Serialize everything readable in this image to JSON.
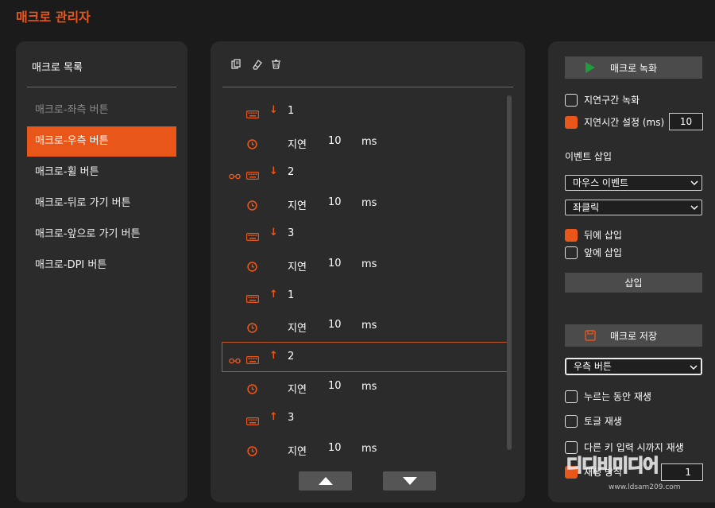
{
  "app": {
    "title": "매크로 관리자"
  },
  "colors": {
    "accent": "#e8561a",
    "panel": "#2b2b2b",
    "background": "#1b1b1b"
  },
  "left": {
    "header": "매크로 목록",
    "items": [
      {
        "label": "매크로-좌측 버튼",
        "state": "dim"
      },
      {
        "label": "매크로-우측 버튼",
        "state": "selected"
      },
      {
        "label": "매크로-휠 버튼",
        "state": "normal"
      },
      {
        "label": "매크로-뒤로 가기 버튼",
        "state": "normal"
      },
      {
        "label": "매크로-앞으로 가기 버튼",
        "state": "normal"
      },
      {
        "label": "매크로-DPI 버튼",
        "state": "normal"
      }
    ]
  },
  "middle": {
    "toolbar": [
      "copy-icon",
      "eraser-icon",
      "trash-icon"
    ],
    "events": [
      {
        "type": "key",
        "link": false,
        "direction": "↓",
        "key": "1"
      },
      {
        "type": "delay",
        "label": "지연",
        "value": "10",
        "unit": "ms"
      },
      {
        "type": "key",
        "link": true,
        "direction": "↓",
        "key": "2"
      },
      {
        "type": "delay",
        "label": "지연",
        "value": "10",
        "unit": "ms"
      },
      {
        "type": "key",
        "link": false,
        "direction": "↓",
        "key": "3"
      },
      {
        "type": "delay",
        "label": "지연",
        "value": "10",
        "unit": "ms"
      },
      {
        "type": "key",
        "link": false,
        "direction": "↑",
        "key": "1"
      },
      {
        "type": "delay",
        "label": "지연",
        "value": "10",
        "unit": "ms"
      },
      {
        "type": "key",
        "link": true,
        "direction": "↑",
        "key": "2",
        "selected": true
      },
      {
        "type": "delay",
        "label": "지연",
        "value": "10",
        "unit": "ms"
      },
      {
        "type": "key",
        "link": false,
        "direction": "↑",
        "key": "3"
      },
      {
        "type": "delay",
        "label": "지연",
        "value": "10",
        "unit": "ms"
      }
    ],
    "nav": [
      "move-up-icon",
      "move-down-icon"
    ]
  },
  "right": {
    "record_button": "매크로 녹화",
    "record_delay": {
      "label": "지연구간 녹화",
      "checked": false
    },
    "set_delay": {
      "label": "지연시간 설정 (ms)",
      "checked": true,
      "value": "10"
    },
    "insert_section": "이벤트 삽입",
    "event_type": "마우스 이벤트",
    "event_action": "좌클릭",
    "insert_after": {
      "label": "뒤에 삽입",
      "checked": true
    },
    "insert_before": {
      "label": "앞에 삽입",
      "checked": false
    },
    "insert_button": "삽입",
    "save_button": "매크로 저장",
    "target_select": "우측 버튼",
    "play_while_pressed": {
      "label": "누르는 동안 재생",
      "checked": false
    },
    "toggle_play": {
      "label": "토글 재생",
      "checked": false
    },
    "play_until_key": {
      "label": "다른 키 입력 시까지 재생",
      "checked": false
    },
    "play_mode": {
      "label": "재생 방식",
      "checked": true,
      "value": "1"
    }
  },
  "watermark": {
    "logo": "디디비미디어",
    "url": "www.ldsam209.com"
  }
}
